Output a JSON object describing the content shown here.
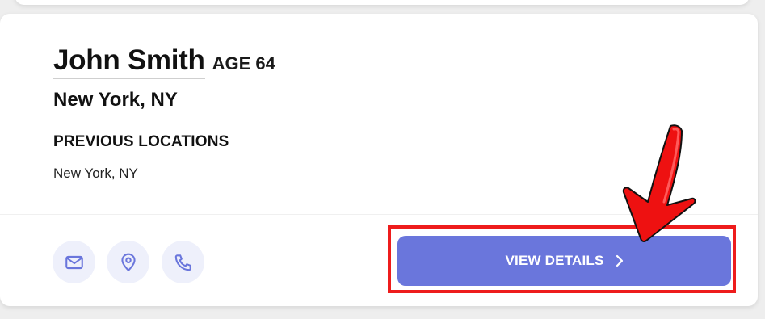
{
  "person": {
    "name": "John Smith",
    "age": "AGE 64",
    "location": "New York, NY"
  },
  "previous_locations": {
    "heading": "PREVIOUS LOCATIONS",
    "items": [
      "New York, NY"
    ]
  },
  "actions": {
    "view_details_label": "VIEW DETAILS",
    "icons": [
      "mail-icon",
      "location-pin-icon",
      "phone-icon"
    ]
  },
  "colors": {
    "accent": "#6a76dc",
    "icon_bg": "#eef0fb",
    "annotation_red": "#ee1c1c"
  }
}
